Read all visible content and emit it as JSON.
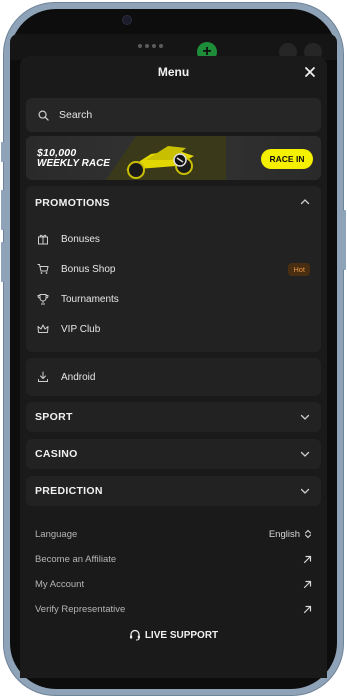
{
  "menu": {
    "title": "Menu",
    "search_label": "Search",
    "banner": {
      "line1": "$10,000",
      "line2": "WEEKLY RACE",
      "cta": "RACE IN",
      "accent": "#f5f000"
    },
    "promotions": {
      "title": "PROMOTIONS",
      "items": [
        {
          "label": "Bonuses",
          "icon": "gift-icon"
        },
        {
          "label": "Bonus Shop",
          "icon": "cart-icon",
          "badge": "Hot"
        },
        {
          "label": "Tournaments",
          "icon": "trophy-icon"
        },
        {
          "label": "VIP Club",
          "icon": "crown-icon"
        }
      ]
    },
    "android_label": "Android",
    "sections": [
      {
        "title": "SPORT"
      },
      {
        "title": "CASINO"
      },
      {
        "title": "PREDICTION"
      }
    ],
    "footer": {
      "language_label": "Language",
      "language_value": "English",
      "affiliate_label": "Become an Affiliate",
      "account_label": "My Account",
      "verify_label": "Verify Representative"
    },
    "live_support": "LIVE SUPPORT"
  }
}
